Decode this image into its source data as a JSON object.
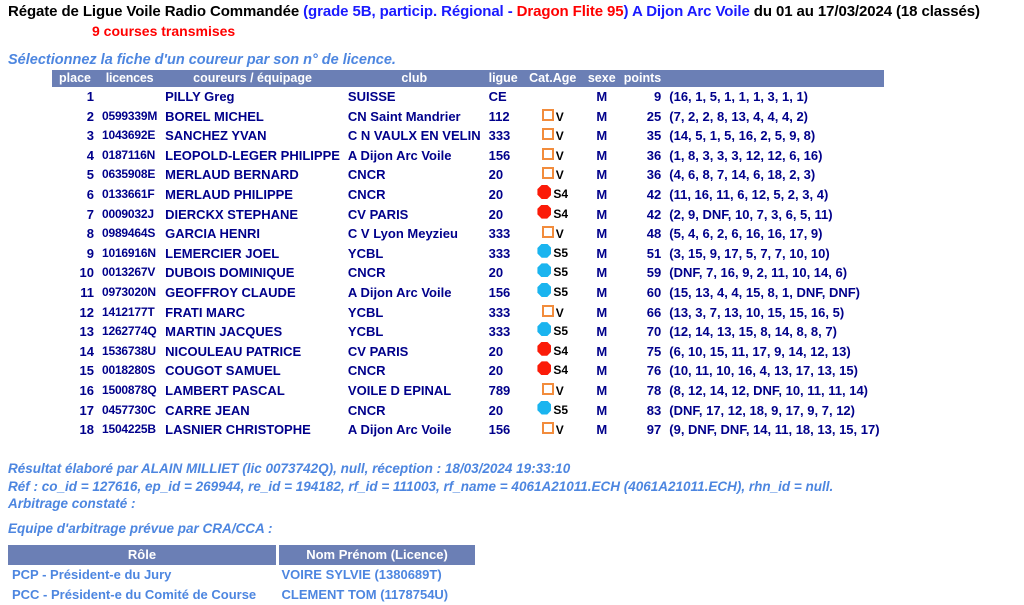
{
  "header": {
    "title_main": "Régate de Ligue Voile Radio Commandée ",
    "title_grade_open": "(grade 5B, particip. Régional - ",
    "title_boat": "Dragon Flite 95",
    "title_grade_close": ")",
    "title_club": " A Dijon Arc Voile ",
    "title_dates": "du 01 au 17/03/2024 (18 classés)",
    "courses": "9 courses transmises",
    "select_hint": "Sélectionnez la fiche d'un coureur par son n° de licence."
  },
  "colors": {
    "header_band": "#6b7fb5",
    "title_black": "#000000",
    "title_blue": "#1a1aff",
    "title_red": "#ff0000",
    "data_blue": "#00008b",
    "note_blue": "#4d86e0",
    "cat_v_outline": "#f28c3c",
    "cat_s4_fill": "#fb1b08",
    "cat_s5_fill": "#1ab4ef"
  },
  "results_table": {
    "columns": [
      "place",
      "licences",
      "coureurs / équipage",
      "club",
      "ligue",
      "Cat.Age",
      "sexe",
      "points"
    ],
    "rows": [
      {
        "place": "1",
        "licence": "",
        "name": "PILLY Greg",
        "club": "SUISSE",
        "ligue": "CE",
        "cat": "",
        "cat_icon": "none",
        "sexe": "M",
        "points": "9",
        "results": "(16, 1, 5, 1, 1, 1, 3, 1, 1)"
      },
      {
        "place": "2",
        "licence": "0599339M",
        "name": "BOREL MICHEL",
        "club": "CN Saint Mandrier",
        "ligue": "112",
        "cat": "V",
        "cat_icon": "square",
        "sexe": "M",
        "points": "25",
        "results": "(7, 2, 2, 8, 13, 4, 4, 4, 2)"
      },
      {
        "place": "3",
        "licence": "1043692E",
        "name": "SANCHEZ YVAN",
        "club": "C N VAULX EN VELIN",
        "ligue": "333",
        "cat": "V",
        "cat_icon": "square",
        "sexe": "M",
        "points": "35",
        "results": "(14, 5, 1, 5, 16, 2, 5, 9, 8)"
      },
      {
        "place": "4",
        "licence": "0187116N",
        "name": "LEOPOLD-LEGER PHILIPPE",
        "club": "A Dijon Arc Voile",
        "ligue": "156",
        "cat": "V",
        "cat_icon": "square",
        "sexe": "M",
        "points": "36",
        "results": "(1, 8, 3, 3, 3, 12, 12, 6, 16)"
      },
      {
        "place": "5",
        "licence": "0635908E",
        "name": "MERLAUD BERNARD",
        "club": "CNCR",
        "ligue": "20",
        "cat": "V",
        "cat_icon": "square",
        "sexe": "M",
        "points": "36",
        "results": "(4, 6, 8, 7, 14, 6, 18, 2, 3)"
      },
      {
        "place": "6",
        "licence": "0133661F",
        "name": "MERLAUD PHILIPPE",
        "club": "CNCR",
        "ligue": "20",
        "cat": "S4",
        "cat_icon": "oct-red",
        "sexe": "M",
        "points": "42",
        "results": "(11, 16, 11, 6, 12, 5, 2, 3, 4)"
      },
      {
        "place": "7",
        "licence": "0009032J",
        "name": "DIERCKX STEPHANE",
        "club": "CV PARIS",
        "ligue": "20",
        "cat": "S4",
        "cat_icon": "oct-red",
        "sexe": "M",
        "points": "42",
        "results": "(2, 9, DNF, 10, 7, 3, 6, 5, 11)"
      },
      {
        "place": "8",
        "licence": "0989464S",
        "name": "GARCIA HENRI",
        "club": "C V Lyon Meyzieu",
        "ligue": "333",
        "cat": "V",
        "cat_icon": "square",
        "sexe": "M",
        "points": "48",
        "results": "(5, 4, 6, 2, 6, 16, 16, 17, 9)"
      },
      {
        "place": "9",
        "licence": "1016916N",
        "name": "LEMERCIER JOEL",
        "club": "YCBL",
        "ligue": "333",
        "cat": "S5",
        "cat_icon": "oct-cyan",
        "sexe": "M",
        "points": "51",
        "results": "(3, 15, 9, 17, 5, 7, 7, 10, 10)"
      },
      {
        "place": "10",
        "licence": "0013267V",
        "name": "DUBOIS DOMINIQUE",
        "club": "CNCR",
        "ligue": "20",
        "cat": "S5",
        "cat_icon": "oct-cyan",
        "sexe": "M",
        "points": "59",
        "results": "(DNF, 7, 16, 9, 2, 11, 10, 14, 6)"
      },
      {
        "place": "11",
        "licence": "0973020N",
        "name": "GEOFFROY CLAUDE",
        "club": "A Dijon Arc Voile",
        "ligue": "156",
        "cat": "S5",
        "cat_icon": "oct-cyan",
        "sexe": "M",
        "points": "60",
        "results": "(15, 13, 4, 4, 15, 8, 1, DNF, DNF)"
      },
      {
        "place": "12",
        "licence": "1412177T",
        "name": "FRATI MARC",
        "club": "YCBL",
        "ligue": "333",
        "cat": "V",
        "cat_icon": "square",
        "sexe": "M",
        "points": "66",
        "results": "(13, 3, 7, 13, 10, 15, 15, 16, 5)"
      },
      {
        "place": "13",
        "licence": "1262774Q",
        "name": "MARTIN JACQUES",
        "club": "YCBL",
        "ligue": "333",
        "cat": "S5",
        "cat_icon": "oct-cyan",
        "sexe": "M",
        "points": "70",
        "results": "(12, 14, 13, 15, 8, 14, 8, 8, 7)"
      },
      {
        "place": "14",
        "licence": "1536738U",
        "name": "NICOULEAU PATRICE",
        "club": "CV PARIS",
        "ligue": "20",
        "cat": "S4",
        "cat_icon": "oct-red",
        "sexe": "M",
        "points": "75",
        "results": "(6, 10, 15, 11, 17, 9, 14, 12, 13)"
      },
      {
        "place": "15",
        "licence": "0018280S",
        "name": "COUGOT SAMUEL",
        "club": "CNCR",
        "ligue": "20",
        "cat": "S4",
        "cat_icon": "oct-red",
        "sexe": "M",
        "points": "76",
        "results": "(10, 11, 10, 16, 4, 13, 17, 13, 15)"
      },
      {
        "place": "16",
        "licence": "1500878Q",
        "name": "LAMBERT PASCAL",
        "club": "VOILE D EPINAL",
        "ligue": "789",
        "cat": "V",
        "cat_icon": "square",
        "sexe": "M",
        "points": "78",
        "results": "(8, 12, 14, 12, DNF, 10, 11, 11, 14)"
      },
      {
        "place": "17",
        "licence": "0457730C",
        "name": "CARRE JEAN",
        "club": "CNCR",
        "ligue": "20",
        "cat": "S5",
        "cat_icon": "oct-cyan",
        "sexe": "M",
        "points": "83",
        "results": "(DNF, 17, 12, 18, 9, 17, 9, 7, 12)"
      },
      {
        "place": "18",
        "licence": "1504225B",
        "name": "LASNIER CHRISTOPHE",
        "club": "A Dijon Arc Voile",
        "ligue": "156",
        "cat": "V",
        "cat_icon": "square",
        "sexe": "M",
        "points": "97",
        "results": "(9, DNF, DNF, 14, 11, 18, 13, 15, 17)"
      }
    ]
  },
  "notes": {
    "line1": "Résultat élaboré par ALAIN MILLIET (lic 0073742Q), null, réception : 18/03/2024 19:33:10",
    "line2": "Réf : co_id = 127616, ep_id = 269944, re_id = 194182, rf_id = 111003, rf_name = 4061A21011.ECH (4061A21011.ECH), rhn_id = null.",
    "line3": "Arbitrage constaté :",
    "line4": "Equipe d'arbitrage prévue par CRA/CCA :"
  },
  "arbitrage_table": {
    "columns": [
      "Rôle",
      "Nom Prénom (Licence)"
    ],
    "rows": [
      {
        "role": "PCP - Président-e du Jury",
        "person": "VOIRE SYLVIE (1380689T)"
      },
      {
        "role": "PCC - Président-e du Comité de Course",
        "person": "CLEMENT TOM (1178754U)"
      }
    ]
  }
}
